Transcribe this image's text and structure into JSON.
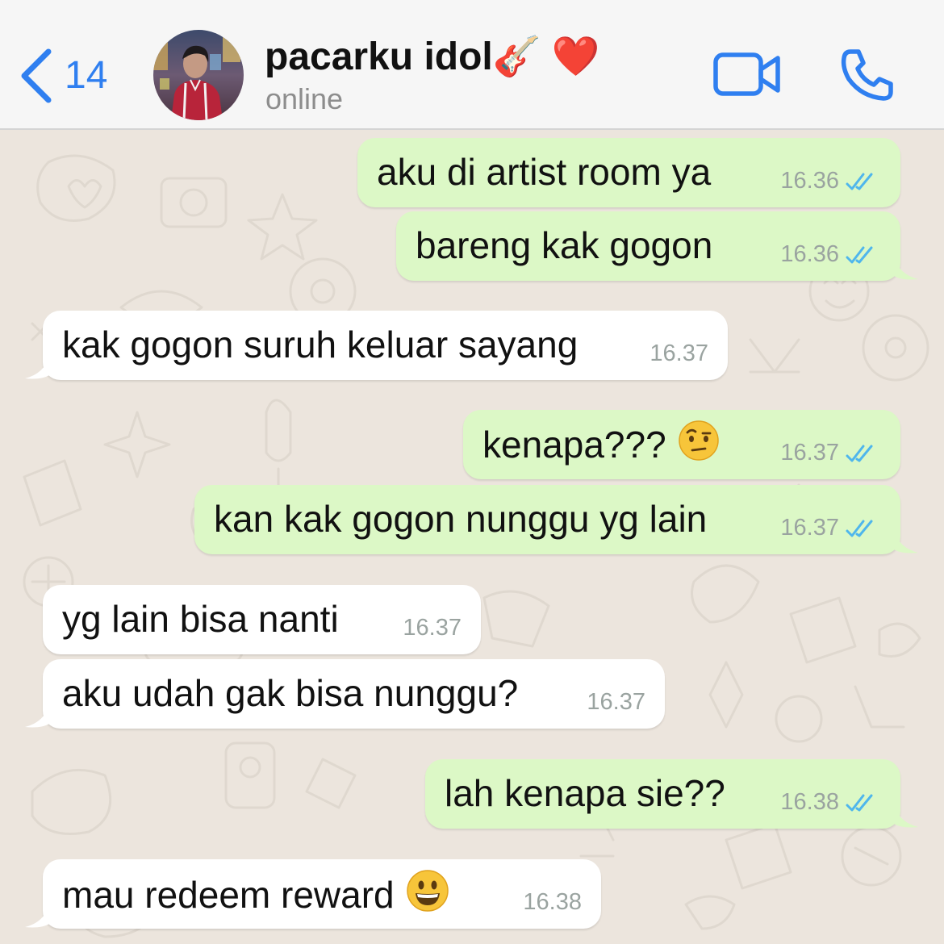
{
  "header": {
    "back_count": "14",
    "contact_name": "pacarku idol🎸 ❤️",
    "status": "online"
  },
  "colors": {
    "accent": "#2f7ff0",
    "outgoing_bubble": "#dcf8c6",
    "incoming_bubble": "#ffffff",
    "read_ticks": "#4fb6ec",
    "wallpaper": "#ece5dd"
  },
  "icons": {
    "back": "chevron-left-icon",
    "video": "video-camera-icon",
    "call": "phone-icon",
    "read_receipt": "double-check-icon"
  },
  "messages": [
    {
      "direction": "out",
      "text": "aku di artist room ya",
      "time": "16.36",
      "read": true
    },
    {
      "direction": "out",
      "text": "bareng kak gogon",
      "time": "16.36",
      "read": true
    },
    {
      "direction": "in",
      "text": "kak gogon suruh keluar sayang",
      "time": "16.37"
    },
    {
      "direction": "out",
      "text": "kenapa???",
      "emoji": "face-with-raised-eyebrow",
      "time": "16.37",
      "read": true
    },
    {
      "direction": "out",
      "text": "kan kak gogon nunggu yg lain",
      "time": "16.37",
      "read": true
    },
    {
      "direction": "in",
      "text": "yg lain bisa nanti",
      "time": "16.37"
    },
    {
      "direction": "in",
      "text": "aku udah gak bisa nunggu?",
      "time": "16.37"
    },
    {
      "direction": "out",
      "text": "lah kenapa sie??",
      "time": "16.38",
      "read": true
    },
    {
      "direction": "in",
      "text": "mau redeem reward",
      "emoji": "grinning-face",
      "time": "16.38"
    }
  ]
}
